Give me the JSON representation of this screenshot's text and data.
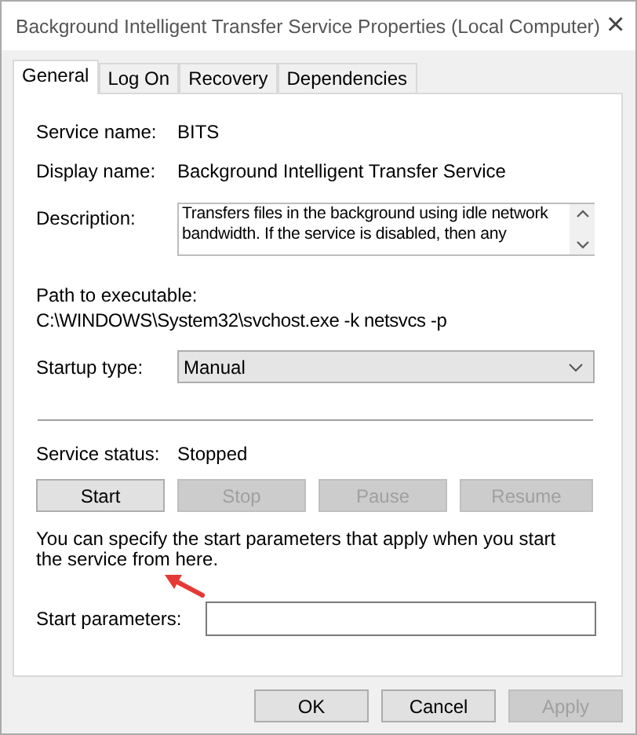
{
  "window": {
    "title": "Background Intelligent Transfer Service Properties (Local Computer)",
    "close": "×"
  },
  "tabs": [
    {
      "label": "General",
      "selected": true
    },
    {
      "label": "Log On",
      "selected": false
    },
    {
      "label": "Recovery",
      "selected": false
    },
    {
      "label": "Dependencies",
      "selected": false
    }
  ],
  "service_name": {
    "label": "Service name:",
    "value": "BITS"
  },
  "display_name": {
    "label": "Display name:",
    "value": "Background Intelligent Transfer Service"
  },
  "description": {
    "label": "Description:",
    "value": "Transfers files in the background using idle network bandwidth. If the service is disabled, then any"
  },
  "path": {
    "label": "Path to executable:",
    "value": "C:\\WINDOWS\\System32\\svchost.exe -k netsvcs -p"
  },
  "startup_type": {
    "label": "Startup type:",
    "value": "Manual"
  },
  "service_status": {
    "label": "Service status:",
    "value": "Stopped"
  },
  "control_buttons": [
    {
      "label": "Start",
      "disabled": false
    },
    {
      "label": "Stop",
      "disabled": true
    },
    {
      "label": "Pause",
      "disabled": true
    },
    {
      "label": "Resume",
      "disabled": true
    }
  ],
  "hint": "You can specify the start parameters that apply when you start the service from here.",
  "start_parameters": {
    "label": "Start parameters:"
  },
  "footer_buttons": [
    {
      "label": "OK",
      "disabled": false
    },
    {
      "label": "Cancel",
      "disabled": false
    },
    {
      "label": "Apply",
      "disabled": true
    }
  ]
}
